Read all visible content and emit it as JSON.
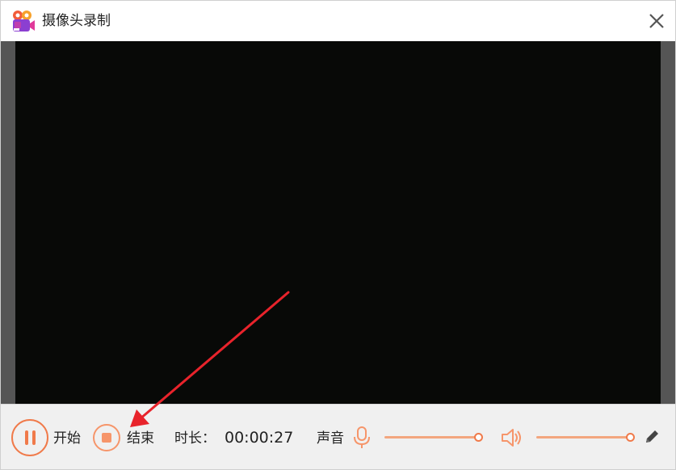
{
  "window": {
    "title": "摄像头录制"
  },
  "icons": {
    "app": "video-camera-icon",
    "close": "close-icon",
    "pause": "pause-icon",
    "stop": "stop-icon",
    "microphone": "microphone-icon",
    "speaker": "speaker-icon",
    "edit": "pencil-icon"
  },
  "controls": {
    "start_label": "开始",
    "stop_label": "结束",
    "duration_label": "时长：",
    "duration_value": "00:00:27",
    "sound_label": "声音",
    "mic_volume": 1.0,
    "speaker_volume": 1.0
  },
  "colors": {
    "accent": "#f07a4a",
    "accent_light": "#f6956a",
    "video_background": "#080907",
    "annotation_arrow": "#e8232b"
  }
}
